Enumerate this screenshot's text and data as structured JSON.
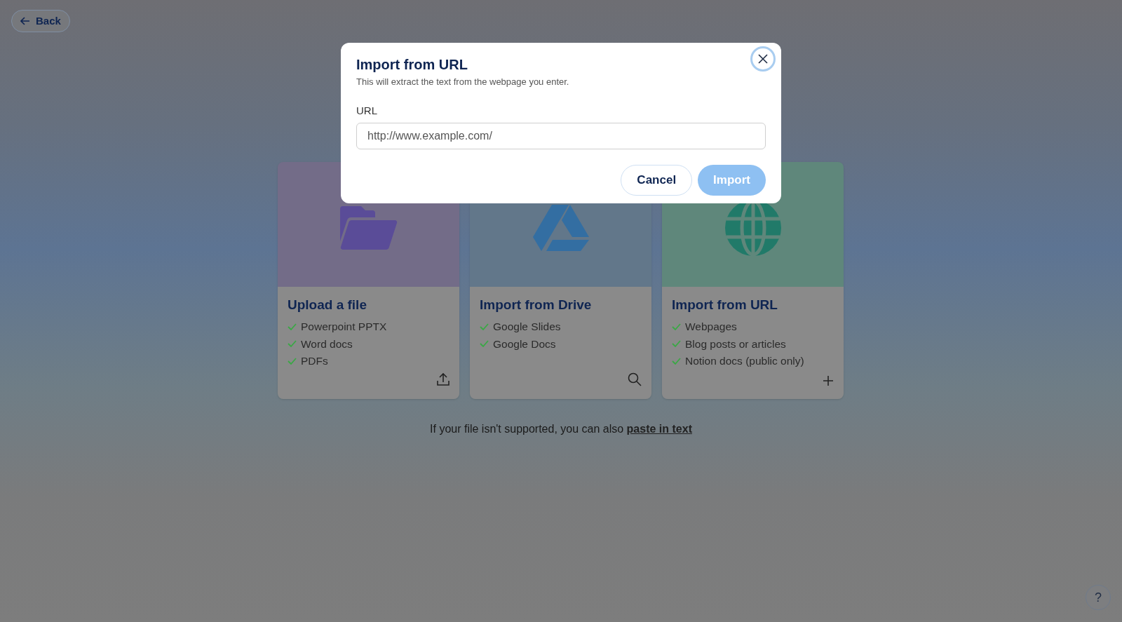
{
  "back_button": {
    "label": "Back"
  },
  "cards": [
    {
      "kind": "upload",
      "color": "#736c88",
      "title": "Upload a file",
      "features": [
        "Powerpoint PPTX",
        "Word docs",
        "PDFs"
      ]
    },
    {
      "kind": "drive",
      "color": "#62778a",
      "title": "Import from Drive",
      "features": [
        "Google Slides",
        "Google Docs"
      ]
    },
    {
      "kind": "url",
      "color": "#5f877b",
      "title": "Import from URL",
      "features": [
        "Webpages",
        "Blog posts or articles",
        "Notion docs (public only)"
      ]
    }
  ],
  "footer": {
    "text": "If your file isn't supported, you can also",
    "link": "paste in text"
  },
  "help_button": {
    "label": "?"
  },
  "dialog": {
    "title": "Import from URL",
    "subtitle": "This will extract the text from the webpage you enter.",
    "field_label": "URL",
    "placeholder": "http://www.example.com/",
    "buttons": [
      {
        "kind": "secondary",
        "label": "Cancel",
        "disabled": false
      },
      {
        "kind": "primary",
        "label": "Import",
        "disabled": true
      }
    ]
  }
}
